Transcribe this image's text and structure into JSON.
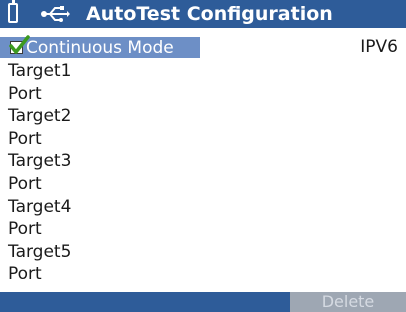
{
  "header": {
    "title": "AutoTest Configuration",
    "icons": [
      "battery-icon",
      "usb-icon"
    ]
  },
  "mode": {
    "label": "Continuous Mode",
    "checked": true,
    "ip_version": "IPV6"
  },
  "targets": [
    {
      "target_label": "Target1",
      "port_label": "Port"
    },
    {
      "target_label": "Target2",
      "port_label": "Port"
    },
    {
      "target_label": "Target3",
      "port_label": "Port"
    },
    {
      "target_label": "Target4",
      "port_label": "Port"
    },
    {
      "target_label": "Target5",
      "port_label": "Port"
    }
  ],
  "footer": {
    "delete_label": "Delete"
  },
  "colors": {
    "title_bar": "#2e5c99",
    "selection": "#6d8fc6",
    "check": "#3c9a1e",
    "disabled_button": "#9ea7b3"
  }
}
